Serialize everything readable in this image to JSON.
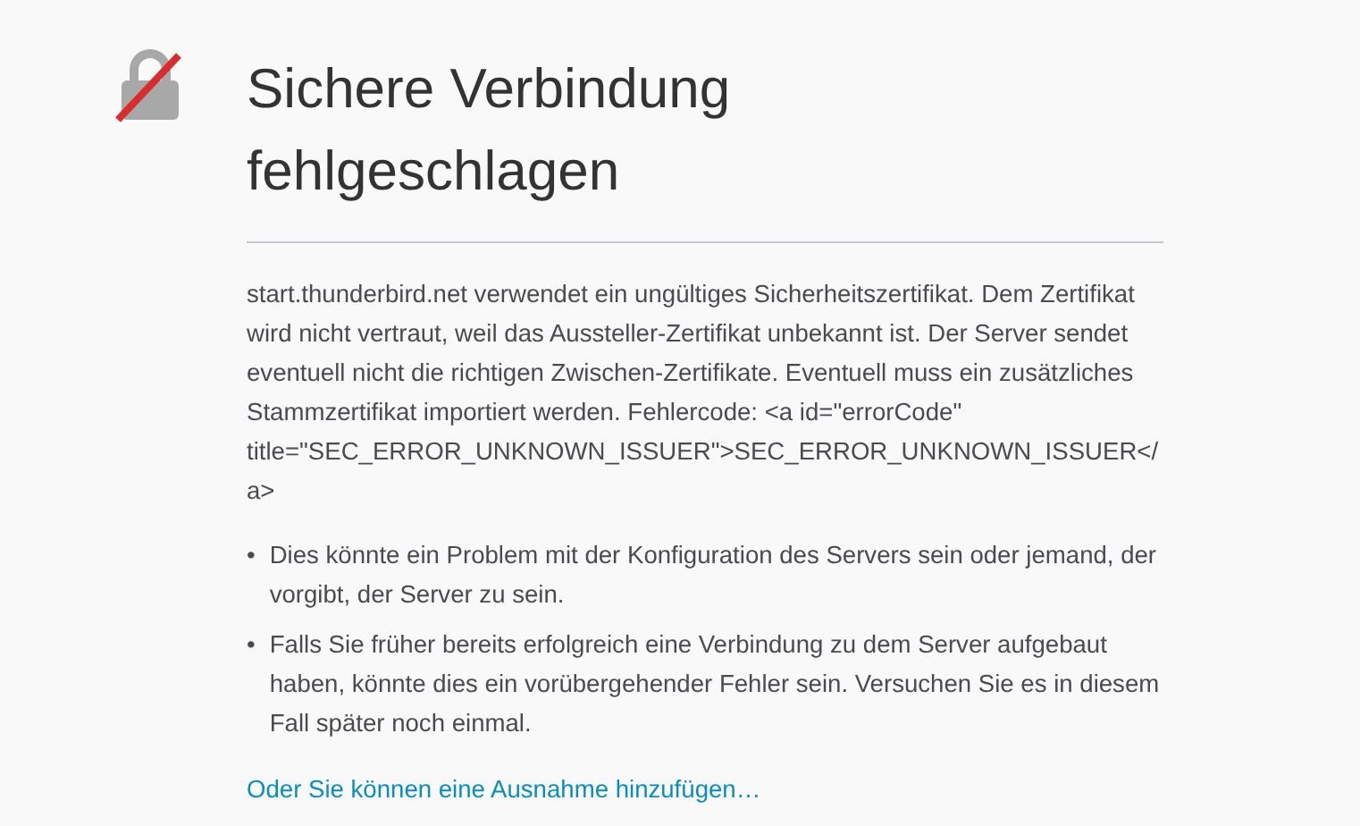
{
  "title": "Sichere Verbindung fehlgeschlagen",
  "description": "start.thunderbird.net verwendet ein ungültiges Sicherheitszertifikat. Dem Zertifikat wird nicht vertraut, weil das Aussteller-Zertifikat unbekannt ist. Der Server sendet eventuell nicht die richtigen Zwischen-Zertifikate. Eventuell muss ein zusätzliches Stammzertifikat importiert werden. Fehlercode: <a id=\"errorCode\" title=\"SEC_ERROR_UNKNOWN_ISSUER\">SEC_ERROR_UNKNOWN_ISSUER</a>",
  "hints": [
    {
      "bullet": "•",
      "text": "Dies könnte ein Problem mit der Konfiguration des Servers sein oder jemand, der vorgibt, der Server zu sein."
    },
    {
      "bullet": "•",
      "text": "Falls Sie früher bereits erfolgreich eine Verbindung zu dem Server aufgebaut haben, könnte dies ein vorübergehender Fehler sein. Versuchen Sie es in diesem Fall später noch einmal."
    }
  ],
  "exception_link": "Oder Sie können eine Ausnahme hinzufügen…"
}
